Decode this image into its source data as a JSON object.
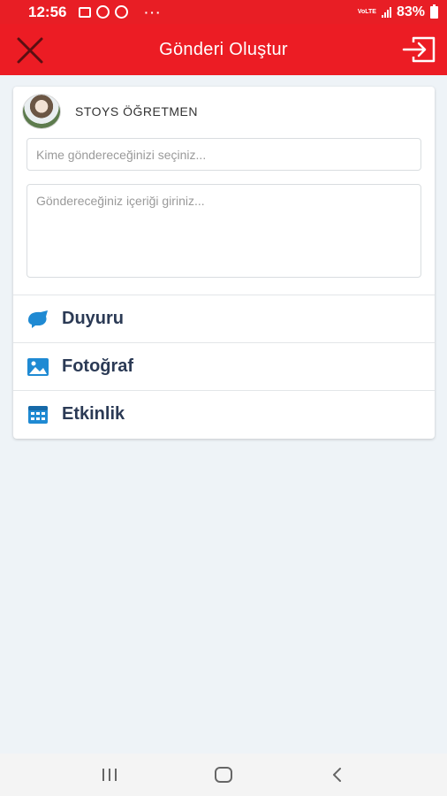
{
  "status_bar": {
    "time": "12:56",
    "dots": "···",
    "network": "VoLTE",
    "battery": "83%"
  },
  "header": {
    "title": "Gönderi Oluştur",
    "close_icon": "close-icon",
    "exit_icon": "exit-icon",
    "background_color": "#ec1c24"
  },
  "composer": {
    "author_name": "STOYS ÖĞRETMEN",
    "recipient_placeholder": "Kime göndereceğinizi seçiniz...",
    "content_placeholder": "Göndereceğiniz içeriği giriniz..."
  },
  "options": [
    {
      "label": "Duyuru",
      "icon": "megaphone-icon"
    },
    {
      "label": "Fotoğraf",
      "icon": "image-icon"
    },
    {
      "label": "Etkinlik",
      "icon": "calendar-icon"
    }
  ],
  "accent_color": "#1f8ad3",
  "nav_bar": {
    "recent": "recent-apps-icon",
    "home": "home-icon",
    "back": "back-icon"
  }
}
